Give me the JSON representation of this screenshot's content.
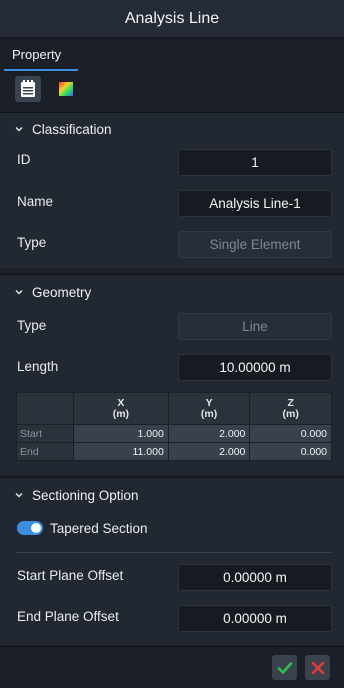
{
  "title": "Analysis Line",
  "tabs": [
    {
      "label": "Property"
    }
  ],
  "icons": {
    "toolbar": [
      "properties-sheet-icon",
      "color-palette-icon"
    ]
  },
  "classification": {
    "header": "Classification",
    "id_label": "ID",
    "id_value": "1",
    "name_label": "Name",
    "name_value": "Analysis Line-1",
    "type_label": "Type",
    "type_value": "Single Element"
  },
  "geometry": {
    "header": "Geometry",
    "type_label": "Type",
    "type_value": "Line",
    "length_label": "Length",
    "length_value": "10.00000 m",
    "table": {
      "columns": [
        {
          "axis": "X",
          "unit": "(m)"
        },
        {
          "axis": "Y",
          "unit": "(m)"
        },
        {
          "axis": "Z",
          "unit": "(m)"
        }
      ],
      "rows": [
        {
          "label": "Start",
          "values": [
            "1.000",
            "2.000",
            "0.000"
          ]
        },
        {
          "label": "End",
          "values": [
            "11.000",
            "2.000",
            "0.000"
          ]
        }
      ]
    }
  },
  "sectioning": {
    "header": "Sectioning Option",
    "tapered_label": "Tapered Section",
    "tapered_on": true,
    "start_label": "Start Plane Offset",
    "start_value": "0.00000 m",
    "end_label": "End Plane Offset",
    "end_value": "0.00000 m"
  },
  "colors": {
    "accent": "#3c8ee0",
    "ok": "#2fbf4a",
    "cancel": "#e23b3b"
  }
}
